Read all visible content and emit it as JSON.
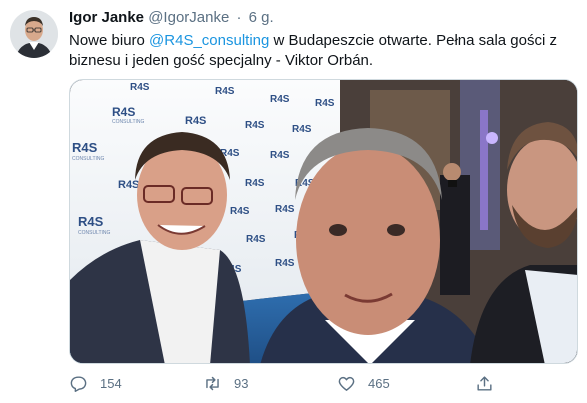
{
  "tweet": {
    "display_name": "Igor Janke",
    "handle": "@IgorJanke",
    "separator": "·",
    "time": "6 g.",
    "text_before": "Nowe biuro ",
    "mention": "@R4S_consulting",
    "text_after": " w Budapeszcie otwarte. Pełna sala gości z biznesu i jeden gość specjalny - Viktor Orbán."
  },
  "photo": {
    "backdrop_logo": "R4S",
    "backdrop_sublabel": "CONSULTING"
  },
  "actions": {
    "reply_count": "154",
    "retweet_count": "93",
    "like_count": "465"
  },
  "icons": {
    "reply": "reply-icon",
    "retweet": "retweet-icon",
    "like": "heart-icon",
    "share": "share-icon"
  },
  "colors": {
    "link": "#1b95e0",
    "secondary_text": "#5b7083",
    "primary_text": "#0f1419"
  }
}
